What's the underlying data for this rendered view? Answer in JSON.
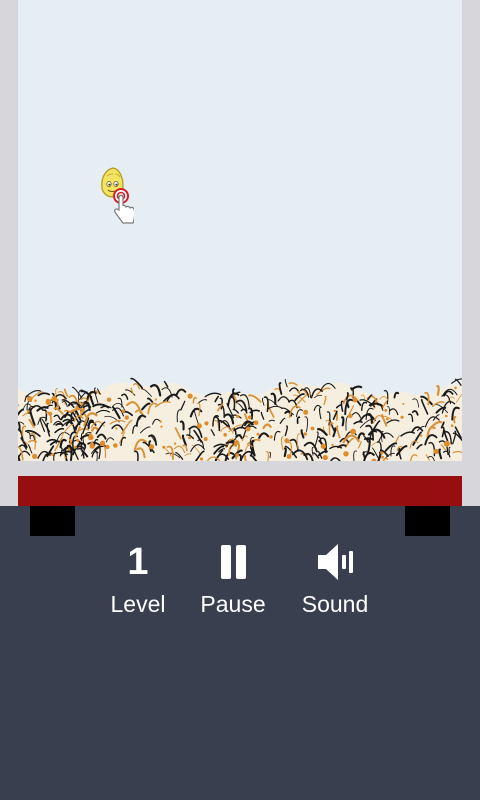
{
  "hud": {
    "level": {
      "value": "1",
      "label": "Level"
    },
    "pause": {
      "label": "Pause",
      "icon": "pause-icon"
    },
    "sound": {
      "label": "Sound",
      "icon": "speaker-icon"
    }
  },
  "colors": {
    "play_area": "#e7eef3",
    "red_bar": "#970e11",
    "panel": "#393f4f",
    "frame": "#d7d6da"
  }
}
